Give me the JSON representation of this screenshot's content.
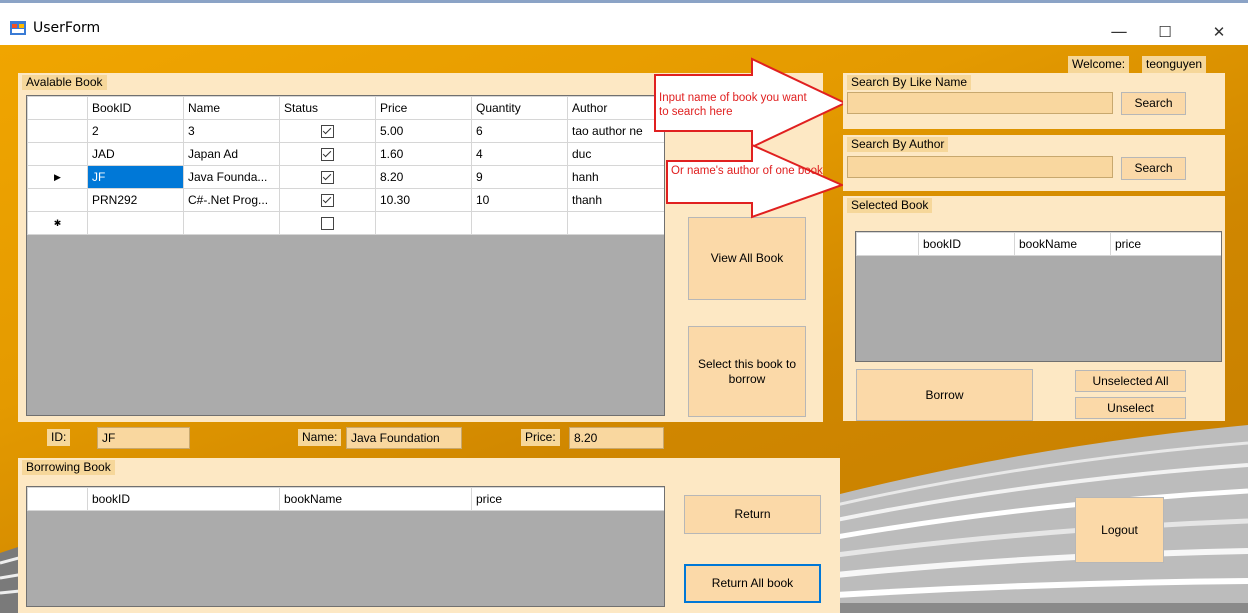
{
  "window": {
    "title": "UserForm",
    "minimize": "—",
    "maximize": "☐",
    "close": "✕"
  },
  "welcome": {
    "label": "Welcome:",
    "user": "teonguyen"
  },
  "available": {
    "caption": "Avalable Book",
    "columns": [
      "BookID",
      "Name",
      "Status",
      "Price",
      "Quantity",
      "Author"
    ],
    "rows": [
      {
        "marker": "",
        "id": "2",
        "name": "3",
        "status": true,
        "price": "5.00",
        "qty": "6",
        "author": "tao author ne"
      },
      {
        "marker": "",
        "id": "JAD",
        "name": "Japan Ad",
        "status": true,
        "price": "1.60",
        "qty": "4",
        "author": "duc"
      },
      {
        "marker": "▶",
        "id": "JF",
        "name": "Java Founda...",
        "status": true,
        "price": "8.20",
        "qty": "9",
        "author": "hanh"
      },
      {
        "marker": "",
        "id": "PRN292",
        "name": "C#-.Net Prog...",
        "status": true,
        "price": "10.30",
        "qty": "10",
        "author": "thanh"
      },
      {
        "marker": "✱",
        "id": "",
        "name": "",
        "status": false,
        "price": "",
        "qty": "",
        "author": ""
      }
    ]
  },
  "details": {
    "id_label": "ID:",
    "id_value": "JF",
    "name_label": "Name:",
    "name_value": "Java Foundation",
    "price_label": "Price:",
    "price_value": "8.20"
  },
  "actions": {
    "view_all": "View All Book",
    "select_borrow": "Select this book to borrow"
  },
  "annotations": {
    "hint1": "Input name of book you want to search here",
    "hint2": "Or name's author of one book"
  },
  "search_name": {
    "caption": "Search By Like Name",
    "value": "",
    "button": "Search"
  },
  "search_author": {
    "caption": "Search By Author",
    "value": "",
    "button": "Search"
  },
  "selected": {
    "caption": "Selected Book",
    "columns": [
      "bookID",
      "bookName",
      "price"
    ],
    "borrow": "Borrow",
    "unselected_all": "Unselected All",
    "unselect": "Unselect"
  },
  "borrowing": {
    "caption": "Borrowing Book",
    "columns": [
      "bookID",
      "bookName",
      "price"
    ],
    "return": "Return",
    "return_all": "Return All book"
  },
  "logout": "Logout",
  "colors": {
    "accent": "#f0a500",
    "panel": "#fde8c4",
    "annotation": "#e02020"
  }
}
